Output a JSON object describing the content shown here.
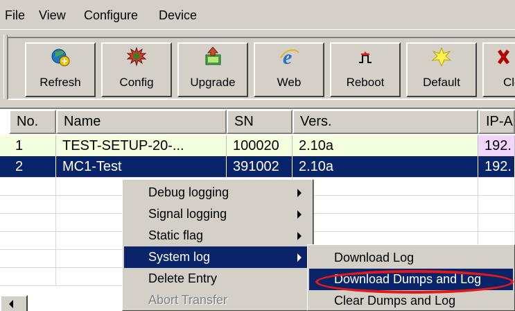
{
  "menubar": {
    "items": [
      "File",
      "View",
      "Configure",
      "Device"
    ]
  },
  "toolbar": {
    "buttons": [
      {
        "label": "Refresh",
        "icon": "refresh-globe-icon"
      },
      {
        "label": "Config",
        "icon": "config-gear-icon"
      },
      {
        "label": "Upgrade",
        "icon": "upgrade-chip-icon"
      },
      {
        "label": "Web",
        "icon": "internet-explorer-icon"
      },
      {
        "label": "Reboot",
        "icon": "reboot-signal-icon"
      },
      {
        "label": "Default",
        "icon": "default-star-icon"
      },
      {
        "label": "Clo",
        "icon": "close-x-icon"
      }
    ]
  },
  "table": {
    "columns": [
      "No.",
      "Name",
      "SN",
      "Vers.",
      "IP-A"
    ],
    "rows": [
      {
        "no": "1",
        "name": "TEST-SETUP-20-...",
        "sn": "100020",
        "vers": "2.10a",
        "ip": "192."
      },
      {
        "no": "2",
        "name": "MC1-Test",
        "sn": "391002",
        "vers": "2.10a",
        "ip": "192."
      }
    ]
  },
  "context_menu": {
    "items": [
      {
        "label": "Debug logging",
        "has_submenu": true,
        "state": "normal"
      },
      {
        "label": "Signal logging",
        "has_submenu": true,
        "state": "normal"
      },
      {
        "label": "Static flag",
        "has_submenu": true,
        "state": "normal"
      },
      {
        "label": "System log",
        "has_submenu": true,
        "state": "highlighted"
      },
      {
        "label": "Delete Entry",
        "has_submenu": false,
        "state": "normal"
      },
      {
        "label": "Abort Transfer",
        "has_submenu": false,
        "state": "disabled"
      }
    ]
  },
  "submenu": {
    "items": [
      {
        "label": "Download Log",
        "state": "normal"
      },
      {
        "label": "Download Dumps and Log",
        "state": "highlighted"
      },
      {
        "label": "Clear Dumps and Log",
        "state": "normal"
      }
    ]
  },
  "colors": {
    "window_gray": "#d4d0c8",
    "selection_blue": "#0a246a",
    "row1_green": "#f4ffde",
    "row1_ip_purple": "#f2d5ff",
    "annotation_red": "#e41818"
  }
}
